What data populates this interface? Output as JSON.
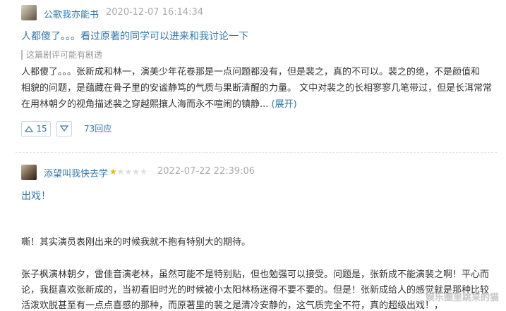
{
  "review1": {
    "username": "公歌我亦能书",
    "time": "2020-12-07 16:14:34",
    "title": "人都傻了。。。看过原著的同学可以进来和我讨论一下",
    "spoiler_note": "这篇剧评可能有剧透",
    "body_lines": [
      "人都傻了。。。张新成和林一，演美少年花卷那是一点问题都没有，但是裴之，真的不可以。裴之的绝，不是颜值和",
      "相貌的问题，是蕴藏在骨子里的安谧静笃的气质与果断清醒的力量。 文中对裴之的长相寥寥几笔带过，但是长洱常常",
      "在用林朝夕的视角描述裴之穿越熙攘人海而永不喧闹的镇静..."
    ],
    "expand_label": "(展开)",
    "upvotes": "15",
    "replies": "73回应"
  },
  "review2": {
    "username": "添望叫我快去学",
    "rating": 1,
    "rating_max": 5,
    "time": "2022-07-22 22:39:06",
    "title": "出戏！",
    "paragraphs": [
      "嘶！其实演员表刚出来的时候我就不抱有特别大的期待。",
      "张子枫演林朝夕，雷佳音演老林，虽然可能不是特别贴，但也勉强可以接受。问题是，张新成不能演裴之啊！平心而",
      "论，我挺喜欢张新成的，当初看旧时光的时候被小太阳林杨迷得不要不要的。但是！张新成给人的感觉就是那种比较",
      "活泼欢脱甚至有一点点喜感的那种，而原著里的裴之是清冷安静的，这气质完全不符，真的超级出戏！，"
    ]
  },
  "watermark": "娱乐圈里跳来的猫",
  "colors": {
    "link": "#3377aa",
    "meta": "#aaaaaa",
    "star_on": "#f7b500",
    "star_off": "#dddddd"
  }
}
